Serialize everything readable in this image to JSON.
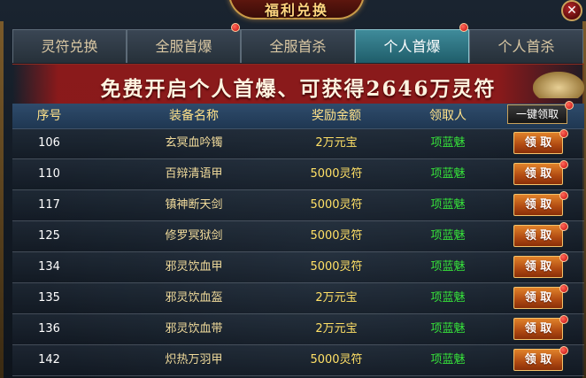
{
  "window": {
    "title": "福利兑换",
    "close_glyph": "✕"
  },
  "tabs": [
    {
      "label": "灵符兑换",
      "active": false,
      "badge": false
    },
    {
      "label": "全服首爆",
      "active": false,
      "badge": true
    },
    {
      "label": "全服首杀",
      "active": false,
      "badge": false
    },
    {
      "label": "个人首爆",
      "active": true,
      "badge": true
    },
    {
      "label": "个人首杀",
      "active": false,
      "badge": false
    }
  ],
  "banner": {
    "text": "免费开启个人首爆、可获得2646万灵符"
  },
  "table": {
    "headers": {
      "id": "序号",
      "name": "装备名称",
      "reward": "奖励金额",
      "receiver": "领取人"
    },
    "one_key_claim_label": "一键领取",
    "claim_label": "领 取",
    "rows": [
      {
        "id": "106",
        "name": "玄冥血吟镯",
        "reward": "2万元宝",
        "receiver": "项蓝魅"
      },
      {
        "id": "110",
        "name": "百辩清语甲",
        "reward": "5000灵符",
        "receiver": "项蓝魅"
      },
      {
        "id": "117",
        "name": "镇神断天剑",
        "reward": "5000灵符",
        "receiver": "项蓝魅"
      },
      {
        "id": "125",
        "name": "修罗冥狱剑",
        "reward": "5000灵符",
        "receiver": "项蓝魅"
      },
      {
        "id": "134",
        "name": "邪灵饮血甲",
        "reward": "5000灵符",
        "receiver": "项蓝魅"
      },
      {
        "id": "135",
        "name": "邪灵饮血盔",
        "reward": "2万元宝",
        "receiver": "项蓝魅"
      },
      {
        "id": "136",
        "name": "邪灵饮血带",
        "reward": "2万元宝",
        "receiver": "项蓝魅"
      },
      {
        "id": "142",
        "name": "炽热万羽甲",
        "reward": "5000灵符",
        "receiver": "项蓝魅"
      }
    ]
  },
  "colors": {
    "active_tab": "#2f7d8c",
    "receiver_green": "#36e03a",
    "reward_gold": "#ffe066",
    "claim_orange": "#d06a20"
  }
}
